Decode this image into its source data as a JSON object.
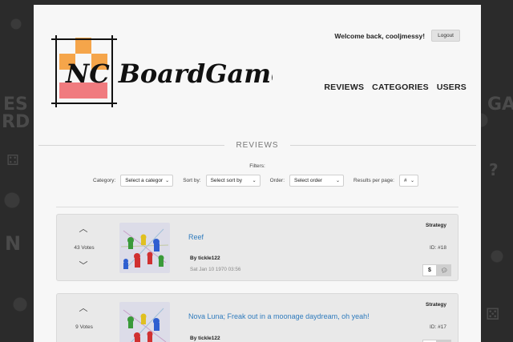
{
  "header": {
    "welcome_text": "Welcome back, cooljmessy!",
    "logout_label": "Logout",
    "logo_text": "NC BoardGames"
  },
  "nav": {
    "items": [
      "REVIEWS",
      "CATEGORIES",
      "USERS"
    ]
  },
  "section_title": "REVIEWS",
  "filters": {
    "label": "Filters:",
    "category_label": "Category:",
    "category_value": "Select a category",
    "sort_label": "Sort by:",
    "sort_value": "Select sort by",
    "order_label": "Order:",
    "order_value": "Select order",
    "per_page_label": "Results per page:",
    "per_page_value": "#"
  },
  "reviews": [
    {
      "votes": "43 Votes",
      "title": "Reef",
      "author": "By tickle122",
      "date": "Sat Jan 10 1970 03:56",
      "category": "Strategy",
      "id": "ID: #18",
      "dollar_label": "$"
    },
    {
      "votes": "9 Votes",
      "title": "Nova Luna; Freak out in a moonage daydream, oh yeah!",
      "author": "By tickle122",
      "date": "",
      "category": "Strategy",
      "id": "ID: #17",
      "dollar_label": "$"
    }
  ],
  "colors": {
    "link": "#2f7bbd",
    "logo_orange": "#f5a54a",
    "logo_pink": "#f07b7f",
    "background": "#2b2b2b"
  }
}
